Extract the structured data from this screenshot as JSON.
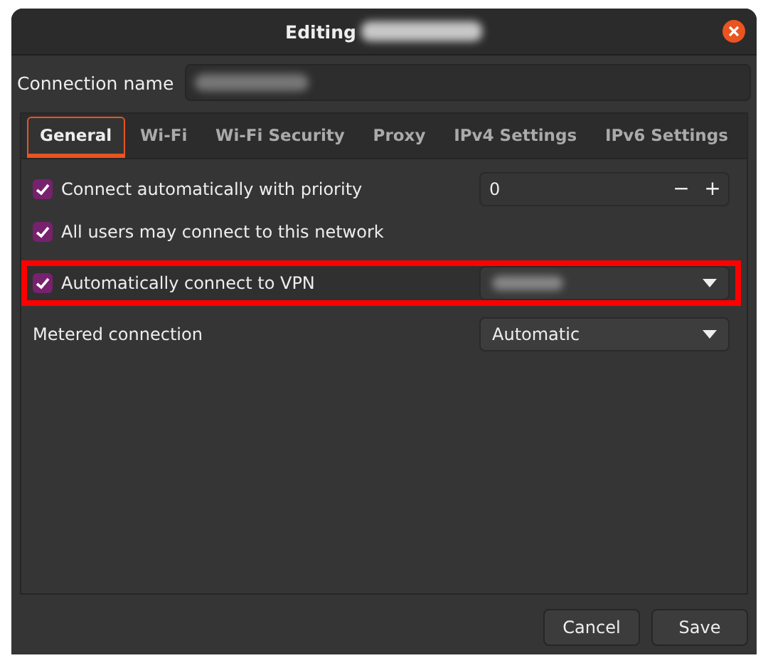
{
  "window": {
    "title": "Editing",
    "title_redacted": true
  },
  "connection_name": {
    "label": "Connection name",
    "redacted": true
  },
  "tabs": [
    {
      "label": "General",
      "selected": true
    },
    {
      "label": "Wi-Fi",
      "selected": false
    },
    {
      "label": "Wi-Fi Security",
      "selected": false
    },
    {
      "label": "Proxy",
      "selected": false
    },
    {
      "label": "IPv4 Settings",
      "selected": false
    },
    {
      "label": "IPv6 Settings",
      "selected": false
    }
  ],
  "options": [
    {
      "kind": "priority",
      "label": "Connect automatically with priority",
      "checked": true,
      "value": "0",
      "minus": "−",
      "plus": "+",
      "highlighted": false
    },
    {
      "kind": "check",
      "label": "All users may connect to this network",
      "checked": true,
      "highlighted": false
    },
    {
      "kind": "dropdown",
      "label": "Automatically connect to VPN",
      "checked": true,
      "redacted": true,
      "highlighted": true
    },
    {
      "kind": "select",
      "label": "Metered connection",
      "value": "Automatic",
      "highlighted": false
    }
  ],
  "buttons": [
    "Cancel",
    "Save"
  ]
}
